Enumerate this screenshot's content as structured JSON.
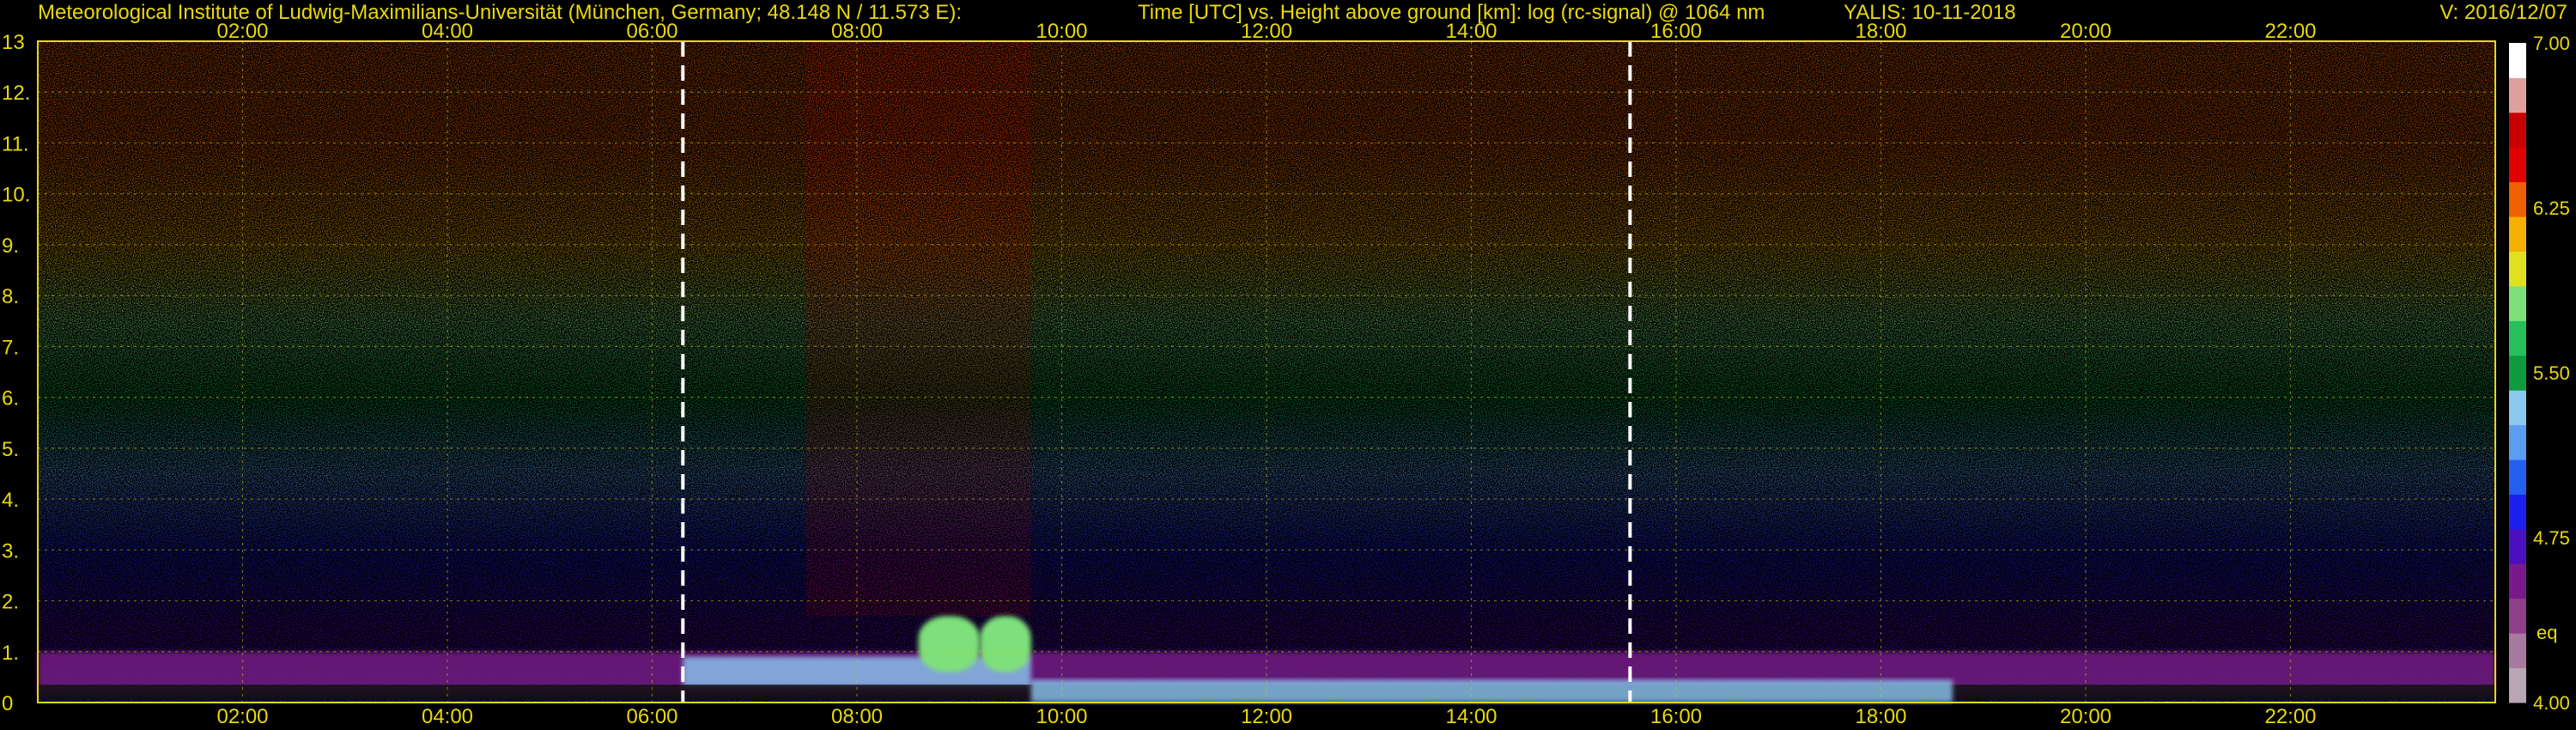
{
  "header": {
    "institute": "Meteorological Institute of Ludwig-Maximilians-Universität (München, Germany; 48.148 N / 11.573 E):",
    "axes_title": "Time [UTC] vs. Height above ground [km]: log (rc-signal) @ 1064 nm",
    "station": "YALIS: 10-11-2018",
    "version": "V: 2016/12/07"
  },
  "colorbar": {
    "ticks": [
      {
        "value": 4.0,
        "label": "4.00"
      },
      {
        "value": 4.75,
        "label": "4.75"
      },
      {
        "value": 5.5,
        "label": "5.50"
      },
      {
        "value": 6.25,
        "label": "6.25"
      },
      {
        "value": 7.0,
        "label": "7.00"
      }
    ],
    "extra_label": "eq",
    "colors": [
      "#b9a6b4",
      "#a87aa0",
      "#8f3f8a",
      "#7a1a8a",
      "#4a10c0",
      "#1c20ee",
      "#2460f0",
      "#5a9ef0",
      "#8ac8f0",
      "#0f9a3c",
      "#26c05a",
      "#7ee07a",
      "#e0e020",
      "#f5b000",
      "#f06000",
      "#e00000",
      "#c80000",
      "#e0a0a0",
      "#ffffff"
    ]
  },
  "chart_data": {
    "type": "heatmap",
    "x_unit": "UTC hour",
    "xlim": [
      0,
      24
    ],
    "ylim": [
      0,
      13
    ],
    "x_ticks": [
      {
        "value": 2,
        "label": "02:00"
      },
      {
        "value": 4,
        "label": "04:00"
      },
      {
        "value": 6,
        "label": "06:00"
      },
      {
        "value": 8,
        "label": "08:00"
      },
      {
        "value": 10,
        "label": "10:00"
      },
      {
        "value": 12,
        "label": "12:00"
      },
      {
        "value": 14,
        "label": "14:00"
      },
      {
        "value": 16,
        "label": "16:00"
      },
      {
        "value": 18,
        "label": "18:00"
      },
      {
        "value": 20,
        "label": "20:00"
      },
      {
        "value": 22,
        "label": "22:00"
      }
    ],
    "y_ticks": [
      0,
      1,
      2,
      3,
      4,
      5,
      6,
      7,
      8,
      9,
      10,
      11,
      12,
      13
    ],
    "grid": true,
    "color_scale": {
      "min": 4.0,
      "max": 7.0
    },
    "markers": [
      6.3,
      15.55
    ],
    "height_profile": [
      {
        "height": 0.3,
        "value": 5.0
      },
      {
        "height": 0.8,
        "value": 4.6
      },
      {
        "height": 1.5,
        "value": 4.7
      },
      {
        "height": 3.0,
        "value": 4.85
      },
      {
        "height": 4.5,
        "value": 5.2
      },
      {
        "height": 6.0,
        "value": 5.5
      },
      {
        "height": 7.5,
        "value": 5.8
      },
      {
        "height": 9.0,
        "value": 6.1
      },
      {
        "height": 11.0,
        "value": 6.25
      },
      {
        "height": 13.0,
        "value": 6.3
      }
    ],
    "features": [
      {
        "name": "boundary-layer",
        "x": [
          0.0,
          24.0
        ],
        "y": [
          0.15,
          1.0
        ],
        "value": 4.5
      },
      {
        "name": "aerosol-layer",
        "x": [
          6.3,
          9.7
        ],
        "y": [
          0.3,
          0.9
        ],
        "value": 5.3
      },
      {
        "name": "cloud",
        "x": [
          8.6,
          9.2
        ],
        "y": [
          0.6,
          1.7
        ],
        "value": 5.9
      },
      {
        "name": "cloud",
        "x": [
          9.2,
          9.7
        ],
        "y": [
          0.6,
          1.7
        ],
        "value": 5.9
      },
      {
        "name": "low-signal-band",
        "x": [
          0.0,
          24.0
        ],
        "y": [
          0.05,
          0.35
        ],
        "value": 4.0
      },
      {
        "name": "near-ground-layer",
        "x": [
          9.7,
          18.7
        ],
        "y": [
          0.0,
          0.45
        ],
        "value": 5.4
      },
      {
        "name": "noisy-sky",
        "x": [
          7.5,
          9.7
        ],
        "y": [
          1.7,
          13.0
        ],
        "value": 6.5
      }
    ]
  }
}
